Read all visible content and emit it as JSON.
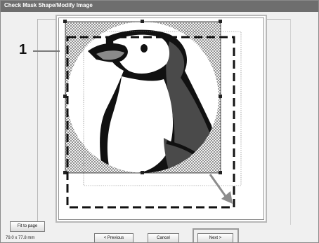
{
  "window": {
    "title": "Check Mask Shape/Modify Image"
  },
  "callout": {
    "label": "1"
  },
  "status": {
    "size": "79.0 x 77.8 mm"
  },
  "buttons": {
    "fit_to_page": "Fit to page",
    "previous": "< Previous",
    "cancel": "Cancel",
    "next": "Next >"
  },
  "colors": {
    "title_bar": "#6e6e6e",
    "window_bg": "#f0f0f0",
    "penguin_dark": "#111111",
    "penguin_gray": "#4a4a4a",
    "mask_hatch": "#555555"
  }
}
